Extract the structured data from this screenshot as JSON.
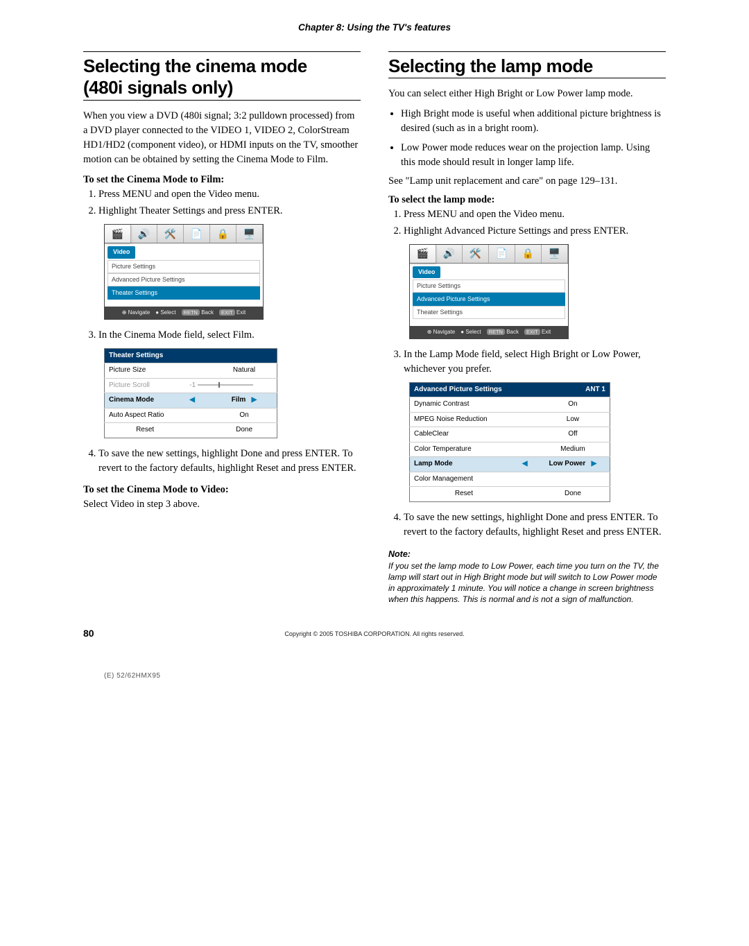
{
  "chapter_header": "Chapter 8: Using the TV's features",
  "left": {
    "title_a": "Selecting the cinema mode",
    "title_b": "(480i signals only)",
    "intro": "When you view a DVD (480i signal; 3:2 pulldown processed) from a DVD player connected to the VIDEO 1, VIDEO 2, ColorStream HD1/HD2 (component video), or HDMI inputs on the TV, smoother motion can be obtained by setting the Cinema Mode to Film.",
    "subhead1": "To set the Cinema Mode to Film:",
    "step1": "Press MENU and open the Video menu.",
    "step2": "Highlight Theater Settings and press ENTER.",
    "menu": {
      "label": "Video",
      "items": [
        "Picture Settings",
        "Advanced Picture Settings",
        "Theater Settings"
      ],
      "footer_nav": "Navigate",
      "footer_sel": "Select",
      "footer_back": "Back",
      "footer_exit": "Exit"
    },
    "step3": "In the Cinema Mode field, select Film.",
    "table": {
      "header": "Theater Settings",
      "rows": [
        {
          "k": "Picture Size",
          "v": "Natural"
        },
        {
          "k": "Picture Scroll",
          "v": "-1"
        },
        {
          "k": "Cinema Mode",
          "v": "Film"
        },
        {
          "k": "Auto Aspect Ratio",
          "v": "On"
        }
      ],
      "reset": "Reset",
      "done": "Done"
    },
    "step4": "To save the new settings, highlight Done and press ENTER. To revert to the factory defaults, highlight Reset and press ENTER.",
    "subhead2": "To set the Cinema Mode to Video:",
    "closing": "Select Video in step 3 above."
  },
  "right": {
    "title": "Selecting the lamp mode",
    "intro": "You can select either High Bright or Low Power lamp mode.",
    "bullets": [
      "High Bright mode is useful when additional picture brightness is desired (such as in a bright room).",
      "Low Power mode reduces wear on the projection lamp. Using this mode should result in longer lamp life."
    ],
    "seeref": "See \"Lamp unit replacement and care\" on page 129–131.",
    "subhead1": "To select the lamp mode:",
    "step1": "Press MENU and open the Video menu.",
    "step2": "Highlight Advanced Picture Settings and press ENTER.",
    "menu": {
      "label": "Video",
      "items": [
        "Picture Settings",
        "Advanced Picture Settings",
        "Theater Settings"
      ],
      "footer_nav": "Navigate",
      "footer_sel": "Select",
      "footer_back": "Back",
      "footer_exit": "Exit"
    },
    "step3": "In the Lamp Mode field, select High Bright or Low Power, whichever you prefer.",
    "table": {
      "header": "Advanced Picture Settings",
      "ant": "ANT 1",
      "rows": [
        {
          "k": "Dynamic Contrast",
          "v": "On"
        },
        {
          "k": "MPEG Noise Reduction",
          "v": "Low"
        },
        {
          "k": "CableClear",
          "v": "Off"
        },
        {
          "k": "Color Temperature",
          "v": "Medium"
        },
        {
          "k": "Lamp Mode",
          "v": "Low Power"
        },
        {
          "k": "Color Management",
          "v": ""
        }
      ],
      "reset": "Reset",
      "done": "Done"
    },
    "step4": "To save the new settings, highlight Done and press ENTER. To revert to the factory defaults, highlight Reset and press ENTER.",
    "note_head": "Note:",
    "note_body": "If you set the lamp mode to Low Power, each time you turn on the TV, the lamp will start out in High Bright mode but will switch to Low Power mode in approximately 1 minute. You will notice a change in screen brightness when this happens. This is normal and is not a sign of malfunction."
  },
  "page_number": "80",
  "copyright": "Copyright © 2005 TOSHIBA CORPORATION. All rights reserved.",
  "footer_code": "(E) 52/62HMX95"
}
